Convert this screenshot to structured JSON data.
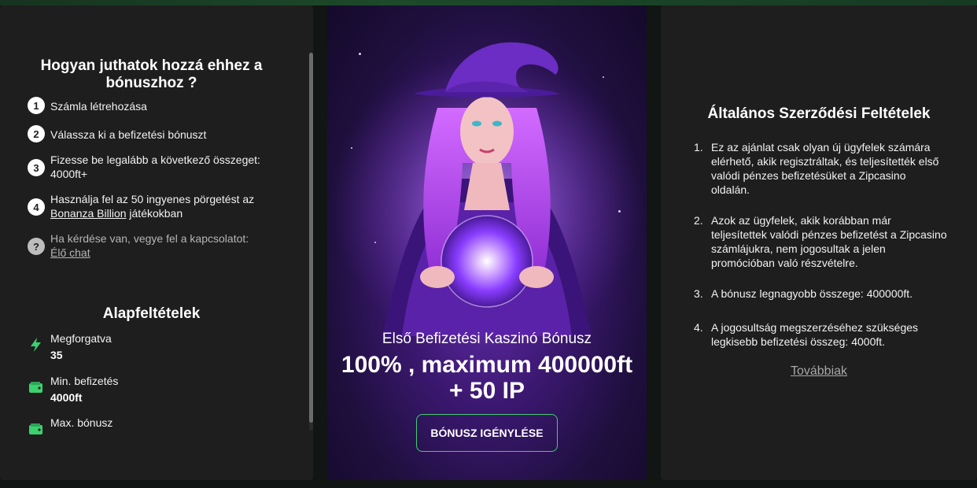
{
  "left": {
    "title": "Hogyan juthatok hozzá ehhez a bónuszhoz ?",
    "steps": [
      {
        "num": "1",
        "text": "Számla létrehozása"
      },
      {
        "num": "2",
        "text": "Válassza ki a befizetési bónuszt"
      },
      {
        "num": "3",
        "text": "Fizesse be legalább a következő összeget: 4000ft+"
      },
      {
        "num": "4",
        "text_before": "Használja fel az 50 ingyenes pörgetést az",
        "link": "Bonanza Billion",
        "text_after": " játékokban"
      },
      {
        "num": "?",
        "text": "Ha kérdése van, vegye fel a kapcsolatot:",
        "link": "Élő chat"
      }
    ],
    "basic_title": "Alapfeltételek",
    "conditions": [
      {
        "label": "Megforgatva",
        "value": "35",
        "icon": "lightning-icon"
      },
      {
        "label": "Min. befizetés",
        "value": "4000ft",
        "icon": "wallet-icon"
      },
      {
        "label": "Max. bónusz",
        "value": "",
        "icon": "wallet-icon"
      }
    ]
  },
  "center": {
    "subtitle": "Első Befizetési Kaszinó Bónusz",
    "headline": "100% , maximum 400000ft + 50 IP",
    "button": "BÓNUSZ IGÉNYLÉSE"
  },
  "right": {
    "title": "Általános Szerződési Feltételek",
    "terms": [
      {
        "n": "1.",
        "text": "Ez az ajánlat csak olyan új ügyfelek számára elérhető, akik regisztráltak, és teljesítették első valódi pénzes befizetésüket a Zipcasino oldalán."
      },
      {
        "n": "2.",
        "text": "Azok az ügyfelek, akik korábban már teljesítettek valódi pénzes befizetést a Zipcasino számlájukra, nem jogosultak a jelen promócióban való részvételre."
      },
      {
        "n": "3.",
        "text": "A bónusz legnagyobb összege: 400000ft."
      },
      {
        "n": "4.",
        "text": "A jogosultság megszerzéséhez szükséges legkisebb befizetési összeg: 4000ft."
      }
    ],
    "more": "Továbbiak"
  },
  "colors": {
    "accent": "#3bd16f",
    "panel": "#1e1e1e",
    "background": "#111513"
  }
}
